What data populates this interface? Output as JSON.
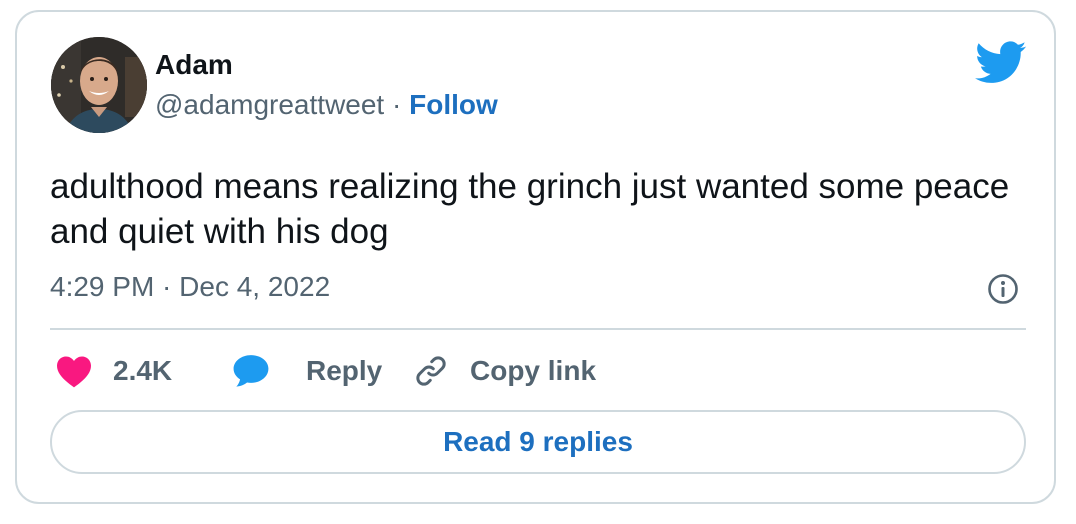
{
  "author": {
    "name": "Adam",
    "handle": "@adamgreattweet",
    "separator": "·",
    "follow_label": "Follow"
  },
  "tweet": {
    "text": "adulthood means realizing the grinch just wanted some peace and quiet with his dog",
    "timestamp": "4:29 PM · Dec 4, 2022"
  },
  "actions": {
    "like_count": "2.4K",
    "reply_label": "Reply",
    "copy_link_label": "Copy link"
  },
  "footer": {
    "read_replies_label": "Read 9 replies"
  },
  "icons": {
    "brand": "twitter-bird-icon",
    "info": "info-icon",
    "like": "heart-icon",
    "reply": "speech-bubble-icon",
    "copy": "link-icon"
  },
  "colors": {
    "brand_blue": "#1d9bf0",
    "link_blue": "#1d6fbf",
    "like_pink": "#f91880",
    "text_primary": "#0f1419",
    "text_secondary": "#536471",
    "border": "#cfd9de"
  }
}
